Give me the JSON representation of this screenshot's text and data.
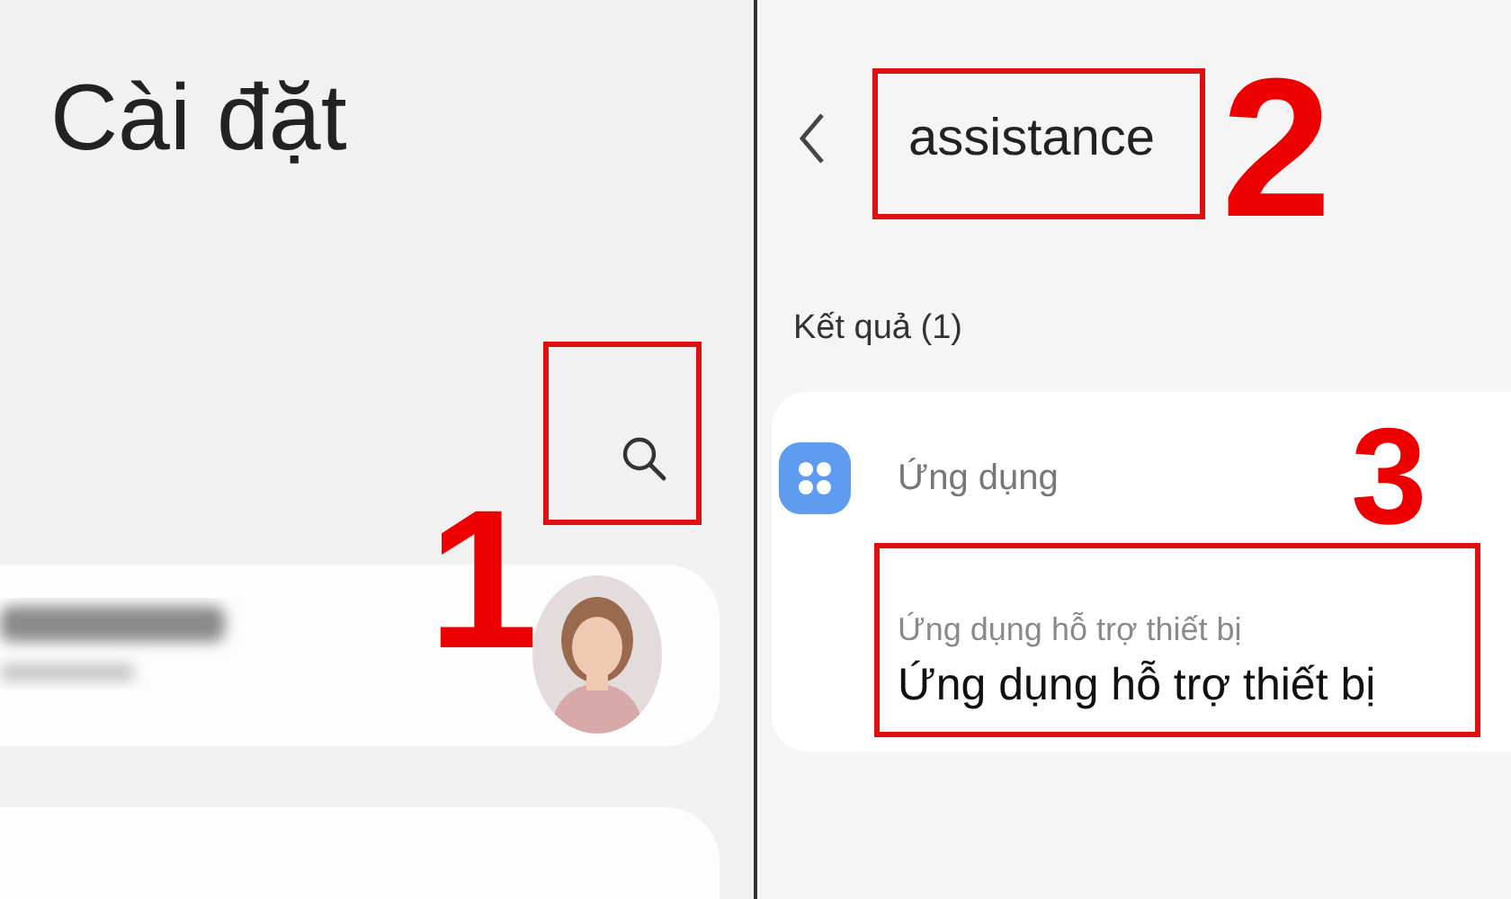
{
  "left_screen": {
    "title": "Cài đặt",
    "annotation": "1"
  },
  "right_screen": {
    "search_query": "assistance",
    "annotation_query": "2",
    "results_heading": "Kết quả (1)",
    "result_group": {
      "category": "Ứng dụng",
      "annotation": "3",
      "result": {
        "path": "Ứng dụng hỗ trợ thiết bị",
        "title": "Ứng dụng hỗ trợ thiết bị"
      }
    }
  }
}
